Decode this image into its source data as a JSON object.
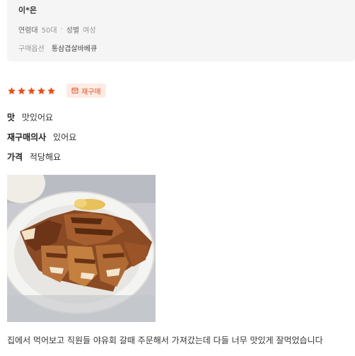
{
  "reviewer": {
    "name": "이*은",
    "age_label": "연령대",
    "age_value": "50대",
    "gender_label": "성별",
    "gender_value": "여성",
    "option_label": "구매옵션",
    "option_value": "통삼겹살바베큐"
  },
  "rating": {
    "stars": 5,
    "max": 5,
    "star_color": "#e8501c",
    "rebuy_badge": "재구매"
  },
  "attributes": [
    {
      "label": "맛",
      "value": "맛있어요"
    },
    {
      "label": "재구매의사",
      "value": "있어요"
    },
    {
      "label": "가격",
      "value": "적당해요"
    }
  ],
  "review": {
    "text": "집에서 먹어보고 직원들 야유회 갈때 주문해서 가져갔는데 다들 너무 맛있게 잘먹었습니다"
  }
}
